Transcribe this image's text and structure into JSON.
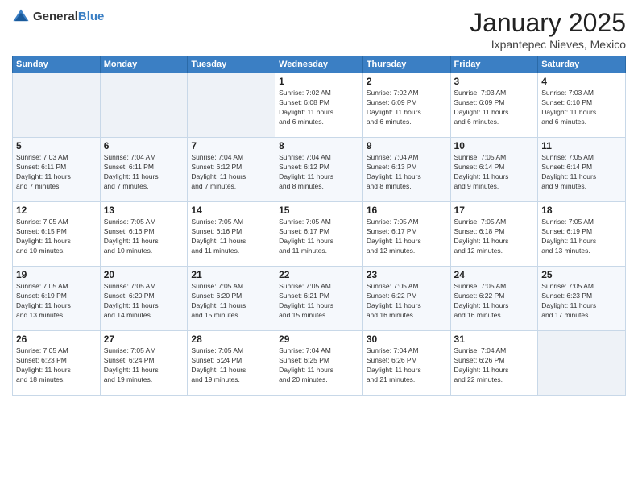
{
  "logo": {
    "general": "General",
    "blue": "Blue"
  },
  "title": "January 2025",
  "location": "Ixpantepec Nieves, Mexico",
  "weekdays": [
    "Sunday",
    "Monday",
    "Tuesday",
    "Wednesday",
    "Thursday",
    "Friday",
    "Saturday"
  ],
  "weeks": [
    [
      {
        "day": "",
        "info": ""
      },
      {
        "day": "",
        "info": ""
      },
      {
        "day": "",
        "info": ""
      },
      {
        "day": "1",
        "info": "Sunrise: 7:02 AM\nSunset: 6:08 PM\nDaylight: 11 hours\nand 6 minutes."
      },
      {
        "day": "2",
        "info": "Sunrise: 7:02 AM\nSunset: 6:09 PM\nDaylight: 11 hours\nand 6 minutes."
      },
      {
        "day": "3",
        "info": "Sunrise: 7:03 AM\nSunset: 6:09 PM\nDaylight: 11 hours\nand 6 minutes."
      },
      {
        "day": "4",
        "info": "Sunrise: 7:03 AM\nSunset: 6:10 PM\nDaylight: 11 hours\nand 6 minutes."
      }
    ],
    [
      {
        "day": "5",
        "info": "Sunrise: 7:03 AM\nSunset: 6:11 PM\nDaylight: 11 hours\nand 7 minutes."
      },
      {
        "day": "6",
        "info": "Sunrise: 7:04 AM\nSunset: 6:11 PM\nDaylight: 11 hours\nand 7 minutes."
      },
      {
        "day": "7",
        "info": "Sunrise: 7:04 AM\nSunset: 6:12 PM\nDaylight: 11 hours\nand 7 minutes."
      },
      {
        "day": "8",
        "info": "Sunrise: 7:04 AM\nSunset: 6:12 PM\nDaylight: 11 hours\nand 8 minutes."
      },
      {
        "day": "9",
        "info": "Sunrise: 7:04 AM\nSunset: 6:13 PM\nDaylight: 11 hours\nand 8 minutes."
      },
      {
        "day": "10",
        "info": "Sunrise: 7:05 AM\nSunset: 6:14 PM\nDaylight: 11 hours\nand 9 minutes."
      },
      {
        "day": "11",
        "info": "Sunrise: 7:05 AM\nSunset: 6:14 PM\nDaylight: 11 hours\nand 9 minutes."
      }
    ],
    [
      {
        "day": "12",
        "info": "Sunrise: 7:05 AM\nSunset: 6:15 PM\nDaylight: 11 hours\nand 10 minutes."
      },
      {
        "day": "13",
        "info": "Sunrise: 7:05 AM\nSunset: 6:16 PM\nDaylight: 11 hours\nand 10 minutes."
      },
      {
        "day": "14",
        "info": "Sunrise: 7:05 AM\nSunset: 6:16 PM\nDaylight: 11 hours\nand 11 minutes."
      },
      {
        "day": "15",
        "info": "Sunrise: 7:05 AM\nSunset: 6:17 PM\nDaylight: 11 hours\nand 11 minutes."
      },
      {
        "day": "16",
        "info": "Sunrise: 7:05 AM\nSunset: 6:17 PM\nDaylight: 11 hours\nand 12 minutes."
      },
      {
        "day": "17",
        "info": "Sunrise: 7:05 AM\nSunset: 6:18 PM\nDaylight: 11 hours\nand 12 minutes."
      },
      {
        "day": "18",
        "info": "Sunrise: 7:05 AM\nSunset: 6:19 PM\nDaylight: 11 hours\nand 13 minutes."
      }
    ],
    [
      {
        "day": "19",
        "info": "Sunrise: 7:05 AM\nSunset: 6:19 PM\nDaylight: 11 hours\nand 13 minutes."
      },
      {
        "day": "20",
        "info": "Sunrise: 7:05 AM\nSunset: 6:20 PM\nDaylight: 11 hours\nand 14 minutes."
      },
      {
        "day": "21",
        "info": "Sunrise: 7:05 AM\nSunset: 6:20 PM\nDaylight: 11 hours\nand 15 minutes."
      },
      {
        "day": "22",
        "info": "Sunrise: 7:05 AM\nSunset: 6:21 PM\nDaylight: 11 hours\nand 15 minutes."
      },
      {
        "day": "23",
        "info": "Sunrise: 7:05 AM\nSunset: 6:22 PM\nDaylight: 11 hours\nand 16 minutes."
      },
      {
        "day": "24",
        "info": "Sunrise: 7:05 AM\nSunset: 6:22 PM\nDaylight: 11 hours\nand 16 minutes."
      },
      {
        "day": "25",
        "info": "Sunrise: 7:05 AM\nSunset: 6:23 PM\nDaylight: 11 hours\nand 17 minutes."
      }
    ],
    [
      {
        "day": "26",
        "info": "Sunrise: 7:05 AM\nSunset: 6:23 PM\nDaylight: 11 hours\nand 18 minutes."
      },
      {
        "day": "27",
        "info": "Sunrise: 7:05 AM\nSunset: 6:24 PM\nDaylight: 11 hours\nand 19 minutes."
      },
      {
        "day": "28",
        "info": "Sunrise: 7:05 AM\nSunset: 6:24 PM\nDaylight: 11 hours\nand 19 minutes."
      },
      {
        "day": "29",
        "info": "Sunrise: 7:04 AM\nSunset: 6:25 PM\nDaylight: 11 hours\nand 20 minutes."
      },
      {
        "day": "30",
        "info": "Sunrise: 7:04 AM\nSunset: 6:26 PM\nDaylight: 11 hours\nand 21 minutes."
      },
      {
        "day": "31",
        "info": "Sunrise: 7:04 AM\nSunset: 6:26 PM\nDaylight: 11 hours\nand 22 minutes."
      },
      {
        "day": "",
        "info": ""
      }
    ]
  ]
}
